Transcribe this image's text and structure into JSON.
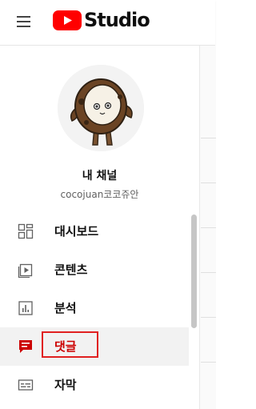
{
  "header": {
    "menu_icon": "hamburger-menu-icon",
    "logo_text": "Studio",
    "brand_color": "#FF0000"
  },
  "channel": {
    "name": "내 채널",
    "handle": "cocojuan코코쥬안"
  },
  "nav": {
    "items": [
      {
        "label": "대시보드",
        "icon": "dashboard-icon",
        "active": false
      },
      {
        "label": "콘텐츠",
        "icon": "content-icon",
        "active": false
      },
      {
        "label": "분석",
        "icon": "analytics-icon",
        "active": false
      },
      {
        "label": "댓글",
        "icon": "comments-icon",
        "active": true
      },
      {
        "label": "자막",
        "icon": "subtitles-icon",
        "active": false
      }
    ]
  },
  "colors": {
    "active_text": "#CC0000",
    "highlight_border": "#E02020",
    "active_background": "#F2F2F2"
  }
}
